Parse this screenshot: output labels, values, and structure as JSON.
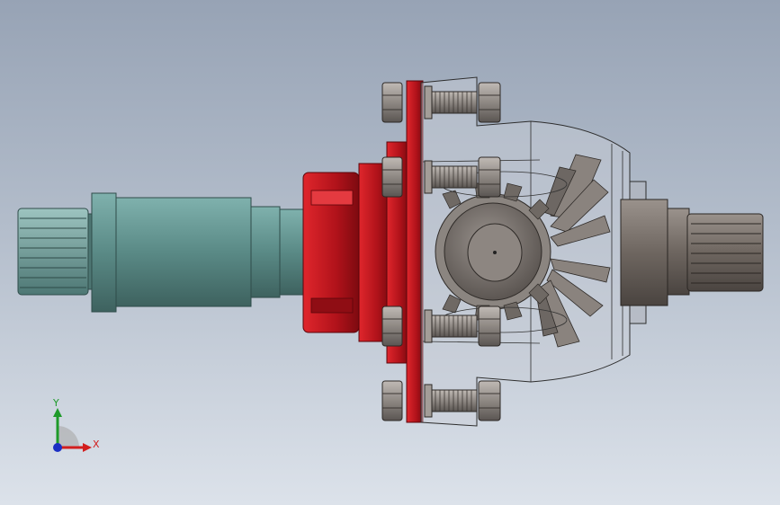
{
  "viewport": {
    "background_top": "#97a3b5",
    "background_bottom": "#dce2ea"
  },
  "model": {
    "name": "differential-shaft-assembly",
    "colors": {
      "shaft": "#5f8f8c",
      "flange_red": "#c0141b",
      "bolt_gray": "#8a8480",
      "housing_glass": "#c9cfd8",
      "gear_gray": "#7c7570",
      "output_shaft": "#6e6660"
    }
  },
  "triad": {
    "x_label": "X",
    "y_label": "Y",
    "x_color": "#d21e1e",
    "y_color": "#1e9a2a",
    "z_color": "#1b2fc4"
  }
}
